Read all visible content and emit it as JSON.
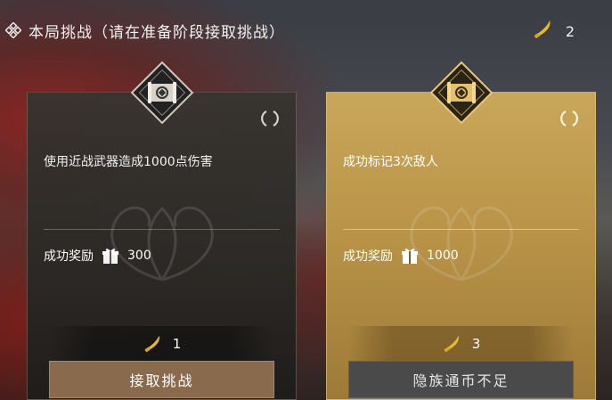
{
  "header": {
    "title": "本局挑战（请在准备阶段接取挑战）",
    "currency_count": "2"
  },
  "cards": [
    {
      "task": "使用近战武器造成1000点伤害",
      "reward_label": "成功奖励",
      "reward_value": "300",
      "cost": "1",
      "button_label": "接取挑战",
      "button_state": "enabled"
    },
    {
      "task": "成功标记3次敌人",
      "reward_label": "成功奖励",
      "reward_value": "1000",
      "cost": "3",
      "button_label": "隐族通币不足",
      "button_state": "disabled"
    }
  ],
  "icons": {
    "title": "diamond-cluster-icon",
    "currency": "golden-blade-coin-icon",
    "card_emblem": "scroll-emblem-icon",
    "refresh": "refresh-icon",
    "reward": "gift-box-icon"
  },
  "colors": {
    "currency": "#e8b830",
    "accept_button": "#8a6a4d",
    "disabled_button": "#4a4a4a",
    "gold_card": "#c9a75a"
  }
}
